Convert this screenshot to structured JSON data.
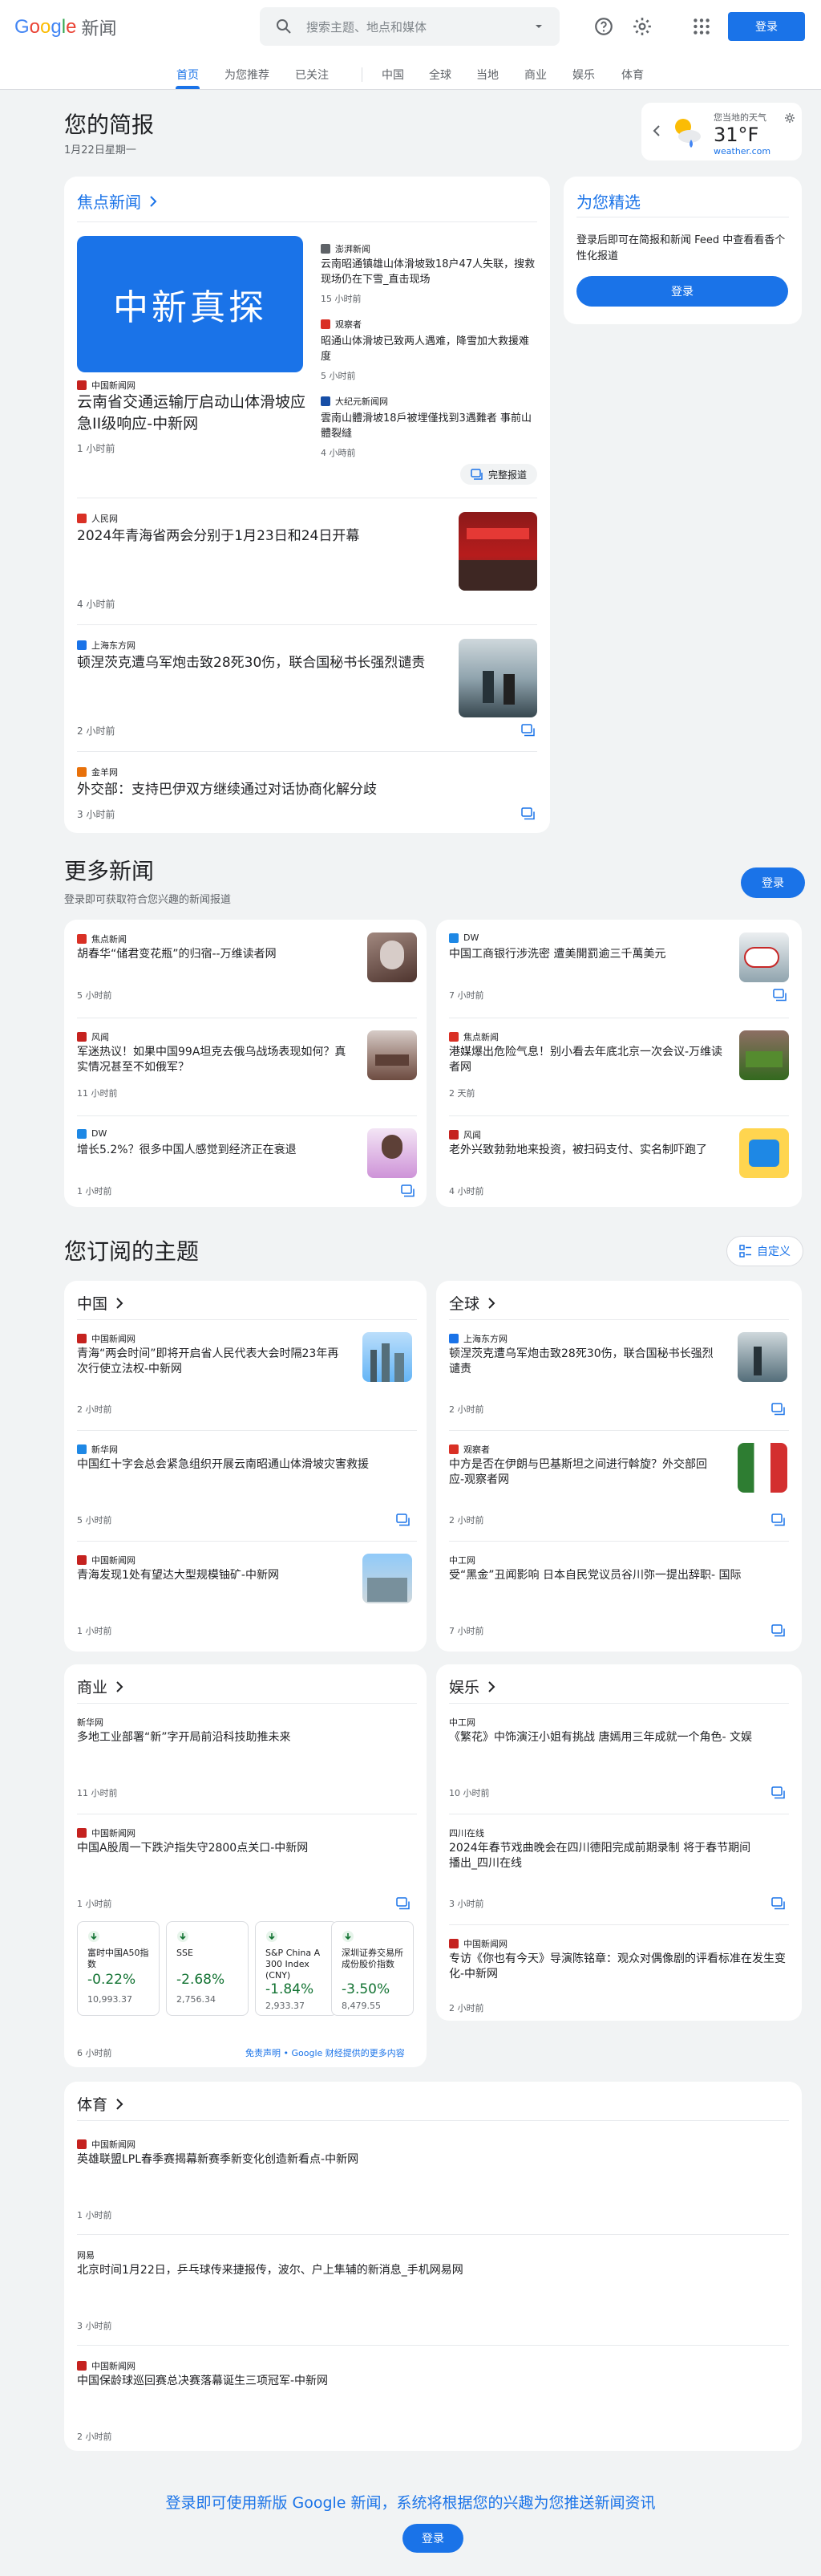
{
  "header": {
    "logo_google": [
      "G",
      "o",
      "o",
      "g",
      "l",
      "e"
    ],
    "logo_news": "新闻",
    "search_placeholder": "搜索主题、地点和媒体",
    "login": "登录"
  },
  "nav": [
    "首页",
    "为您推荐",
    "已关注",
    "中国",
    "全球",
    "当地",
    "商业",
    "娱乐",
    "体育"
  ],
  "briefing": {
    "title": "您的简报",
    "date": "1月22日星期一"
  },
  "weather": {
    "label": "您当地的天气",
    "temp": "31°F",
    "source": "weather.com"
  },
  "top_stories": {
    "title": "焦点新闻",
    "image_text": "中新真探",
    "main": {
      "source": "中国新闻网",
      "headline": "云南省交通运输厅启动山体滑坡应急II级响应-中新网",
      "time": "1 小时前"
    },
    "related": [
      {
        "source": "澎湃新闻",
        "headline": "云南昭通镇雄山体滑坡致18户47人失联，搜救现场仍在下雪_直击现场",
        "time": "15 小时前"
      },
      {
        "source": "观察者",
        "headline": "昭通山体滑坡已致两人遇难，降雪加大救援难度",
        "time": "5 小时前"
      },
      {
        "source": "大纪元新闻网",
        "headline": "雲南山體滑坡18戶被埋僅找到3遇難者 事前山體裂縫",
        "time": "4 小時前"
      }
    ],
    "full_coverage": "完整报道",
    "items": [
      {
        "source": "人民网",
        "headline": "2024年青海省两会分别于1月23日和24日开幕",
        "time": "4 小时前"
      },
      {
        "source": "上海东方网",
        "headline": "顿涅茨克遭乌军炮击致28死30伤，联合国秘书长强烈谴责",
        "time": "2 小时前"
      },
      {
        "source": "金羊网",
        "headline": "外交部：支持巴伊双方继续通过对话协商化解分歧",
        "time": "3 小时前"
      }
    ]
  },
  "for_you": {
    "title": "为您精选",
    "text": "登录后即可在简报和新闻 Feed 中查看看香个性化报道",
    "button": "登录"
  },
  "more_news": {
    "title": "更多新闻",
    "subtitle": "登录即可获取符合您兴趣的新闻报道",
    "button": "登录",
    "items": [
      {
        "source": "焦点新闻",
        "headline": "胡春华“储君变花瓶”的归宿--万维读者网",
        "time": "5 小时前"
      },
      {
        "source": "DW",
        "headline": "中国工商银行涉洗密 遭美開罰逾三千萬美元",
        "time": "7 小时前"
      },
      {
        "source": "风闻",
        "headline": "军迷热议！如果中国99A坦克去俄乌战场表现如何？真实情况甚至不如俄军？",
        "time": "11 小时前"
      },
      {
        "source": "焦点新闻",
        "headline": "港媒爆出危险气息！别小看去年底北京一次会议-万维读者网",
        "time": "2 天前"
      },
      {
        "source": "DW",
        "headline": "增长5.2%？很多中国人感觉到经济正在衰退",
        "time": "1 小时前"
      },
      {
        "source": "风闻",
        "headline": "老外兴致勃勃地来投资，被扫码支付、实名制吓跑了",
        "time": "4 小时前"
      }
    ]
  },
  "subscriptions": {
    "title": "您订阅的主题",
    "customize": "自定义",
    "china": {
      "title": "中国",
      "items": [
        {
          "source": "中国新闻网",
          "headline": "青海“两会时间”即将开启省人民代表大会时隔23年再次行使立法权-中新网",
          "time": "2 小时前"
        },
        {
          "source": "新华网",
          "headline": "中国红十字会总会紧急组织开展云南昭通山体滑坡灾害救援",
          "time": "5 小时前"
        },
        {
          "source": "中国新闻网",
          "headline": "青海发现1处有望达大型规模铀矿-中新网",
          "time": "1 小时前"
        }
      ]
    },
    "world": {
      "title": "全球",
      "items": [
        {
          "source": "上海东方网",
          "headline": "顿涅茨克遭乌军炮击致28死30伤，联合国秘书长强烈谴责",
          "time": "2 小时前"
        },
        {
          "source": "观察者",
          "headline": "中方是否在伊朗与巴基斯坦之间进行斡旋？外交部回应-观察者网",
          "time": "2 小时前"
        },
        {
          "source": "中工网",
          "headline": "受“黑金”丑闻影响 日本自民党议员谷川弥一提出辞职- 国际",
          "time": "7 小时前"
        }
      ]
    },
    "business": {
      "title": "商业",
      "items": [
        {
          "source": "新华网",
          "headline": "多地工业部署“新”字开局前沿科技助推未来",
          "time": "11 小时前"
        },
        {
          "source": "中国新闻网",
          "headline": "中国A股周一下跌沪指失守2800点关口-中新网",
          "time": "1 小时前"
        }
      ],
      "stocks": [
        {
          "name": "富时中国A50指数",
          "pct": "-0.22%",
          "value": "10,993.37"
        },
        {
          "name": "SSE",
          "pct": "-2.68%",
          "value": "2,756.34"
        },
        {
          "name": "S&P China A 300 Index (CNY)",
          "pct": "-1.84%",
          "value": "2,933.37"
        },
        {
          "name": "深圳证券交易所成份股价指数",
          "pct": "-3.50%",
          "value": "8,479.55"
        }
      ],
      "time": "6 小时前",
      "disclaimer": "免责声明 • Google 财经提供的更多内容"
    },
    "entertainment": {
      "title": "娱乐",
      "items": [
        {
          "source": "中工网",
          "headline": "《繁花》中饰演汪小姐有挑战 唐嫣用三年成就一个角色- 文娱",
          "time": "10 小时前"
        },
        {
          "source": "四川在线",
          "headline": "2024年春节戏曲晚会在四川德阳完成前期录制 将于春节期间播出_四川在线",
          "time": "3 小时前"
        },
        {
          "source": "中国新闻网",
          "headline": "专访《你也有今天》导演陈铭章：观众对偶像剧的评看标准在发生变化-中新网",
          "time": "2 小时前"
        }
      ]
    },
    "sports": {
      "title": "体育",
      "items": [
        {
          "source": "中国新闻网",
          "headline": "英雄联盟LPL春季赛揭幕新赛季新变化创造新看点-中新网",
          "time": "1 小时前"
        },
        {
          "source": "网易",
          "headline": "北京时间1月22日，乒乓球传来捷报传，波尔、户上隼辅的新消息_手机网易网",
          "time": "3 小时前"
        },
        {
          "source": "中国新闻网",
          "headline": "中国保龄球巡回赛总决赛落幕诞生三项冠军-中新网",
          "time": "2 小时前"
        }
      ]
    }
  },
  "footer": {
    "text": "登录即可使用新版 Google 新闻，系统将根据您的兴趣为您推送新闻资讯",
    "button": "登录"
  },
  "colors": {
    "accent": "#1a73e8",
    "background": "#f1f3f4",
    "stock_down": "#137333"
  }
}
